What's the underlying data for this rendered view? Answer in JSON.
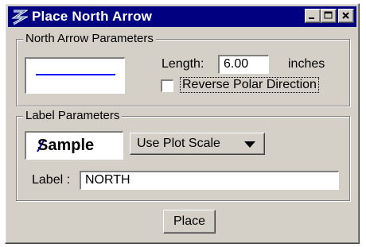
{
  "window": {
    "title": "Place North Arrow"
  },
  "title_buttons": [
    "minimize",
    "maximize",
    "close"
  ],
  "north_arrow_group": {
    "legend": "North Arrow Parameters",
    "length_label": "Length:",
    "length_value": "6.00",
    "length_units": "inches",
    "reverse_label": "Reverse Polar Direction",
    "reverse_checked": false
  },
  "label_group": {
    "legend": "Label Parameters",
    "sample_text": "Sample",
    "scale_option": "Use Plot Scale",
    "label_label": "Label :",
    "label_value": "NORTH"
  },
  "place_button": "Place",
  "colors": {
    "titlebar": "#000080",
    "face": "#d4d0c8",
    "arrow_line": "#0000ff"
  }
}
